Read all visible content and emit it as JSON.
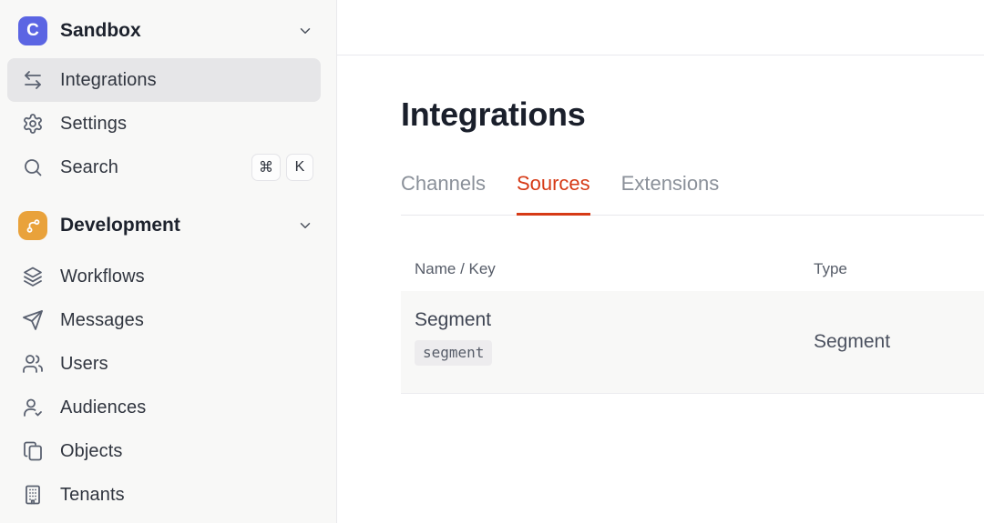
{
  "sidebar": {
    "workspace": {
      "logo_letter": "C",
      "logo_color": "#5B65E3",
      "label": "Sandbox"
    },
    "top_items": [
      {
        "label": "Integrations",
        "icon": "swap-horizontal-icon",
        "active": true
      },
      {
        "label": "Settings",
        "icon": "gear-icon",
        "active": false
      },
      {
        "label": "Search",
        "icon": "search-icon",
        "active": false,
        "shortcut": {
          "meta": "⌘",
          "key": "K"
        }
      }
    ],
    "section": {
      "label": "Development",
      "icon": "git-branch-icon",
      "icon_color": "#E9A23B"
    },
    "dev_items": [
      {
        "label": "Workflows",
        "icon": "layers-icon"
      },
      {
        "label": "Messages",
        "icon": "send-icon"
      },
      {
        "label": "Users",
        "icon": "users-icon"
      },
      {
        "label": "Audiences",
        "icon": "user-check-icon"
      },
      {
        "label": "Objects",
        "icon": "copy-icon"
      },
      {
        "label": "Tenants",
        "icon": "building-icon"
      }
    ]
  },
  "main": {
    "title": "Integrations",
    "accent_color": "#D63A16",
    "tabs": [
      {
        "label": "Channels",
        "active": false
      },
      {
        "label": "Sources",
        "active": true
      },
      {
        "label": "Extensions",
        "active": false
      }
    ],
    "table": {
      "columns": {
        "name_key": "Name / Key",
        "type": "Type"
      },
      "rows": [
        {
          "name": "Segment",
          "key": "segment",
          "type": "Segment"
        }
      ]
    }
  }
}
